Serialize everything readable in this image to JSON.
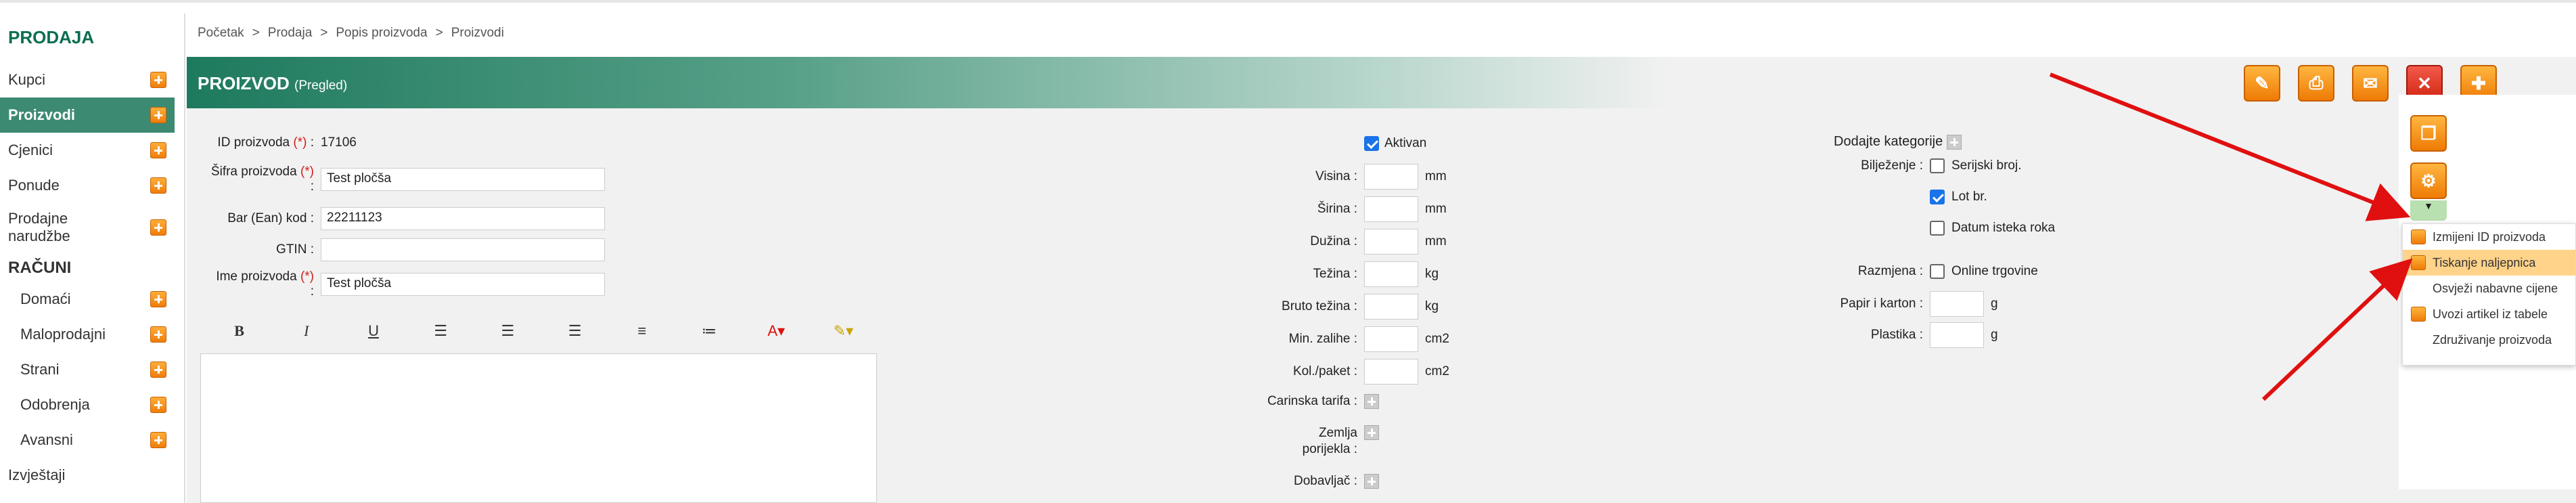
{
  "sidebar": {
    "heading": "PRODAJA",
    "items": [
      {
        "label": "Kupci"
      },
      {
        "label": "Proizvodi"
      },
      {
        "label": "Cjenici"
      },
      {
        "label": "Ponude"
      },
      {
        "label_line1": "Prodajne",
        "label_line2": "narudžbe"
      }
    ],
    "section2": "RAČUNI",
    "sub_items": [
      {
        "label": "Domaći"
      },
      {
        "label": "Maloprodajni"
      },
      {
        "label": "Strani"
      },
      {
        "label": "Odobrenja"
      },
      {
        "label": "Avansni"
      }
    ],
    "last": "Izvještaji"
  },
  "breadcrumb": [
    "Početak",
    "Prodaja",
    "Popis proizvoda",
    "Proizvodi"
  ],
  "breadcrumb_sep": ">",
  "header": {
    "title": "PROIZVOD",
    "subtitle": "(Pregled)"
  },
  "form": {
    "id_label": "ID proizvoda",
    "id_value": "17106",
    "sifra_label": "Šifra proizvoda",
    "sifra_value": "Test pločša",
    "barcode_label": "Bar (Ean) kod",
    "barcode_value": "22211123",
    "gtin_label": "GTIN",
    "gtin_value": "",
    "ime_label": "Ime proizvoda",
    "ime_value": "Test pločša",
    "req_mark": "(*)",
    "colon": ":"
  },
  "middle": {
    "aktivan": "Aktivan",
    "fields": [
      {
        "label": "Visina :",
        "unit": "mm"
      },
      {
        "label": "Širina :",
        "unit": "mm"
      },
      {
        "label": "Dužina :",
        "unit": "mm"
      },
      {
        "label": "Težina :",
        "unit": "kg"
      },
      {
        "label": "Bruto težina :",
        "unit": "kg"
      },
      {
        "label": "Min. zalihe :",
        "unit": "cm2"
      },
      {
        "label": "Kol./paket :",
        "unit": "cm2"
      }
    ],
    "carinska": "Carinska tarifa :",
    "zemlja1": "Zemlja",
    "zemlja2": "porijekla :",
    "dobavljac": "Dobavljač :"
  },
  "right": {
    "kategorije": "Dodajte kategorije",
    "biljezenje": "Bilježenje :",
    "serijski": "Serijski broj.",
    "lot": "Lot br.",
    "datum": "Datum isteka roka",
    "razmjena": "Razmjena :",
    "online": "Online trgovine",
    "papir": "Papir i karton :",
    "papir_unit": "g",
    "plastika": "Plastika :",
    "plastika_unit": "g"
  },
  "dropdown": [
    {
      "label": "Izmijeni ID proizvoda",
      "icon": true
    },
    {
      "label": "Tiskanje naljepnica",
      "icon": true,
      "highlight": true
    },
    {
      "label": "Osvježi nabavne cijene",
      "icon": false
    },
    {
      "label": "Uvozi artikel iz tabele",
      "icon": true
    },
    {
      "label": "Združivanje proizvoda",
      "icon": false
    }
  ],
  "colors": {
    "accent": "#1e7a5e",
    "orange": "#f07d0a",
    "red": "#d22512"
  }
}
